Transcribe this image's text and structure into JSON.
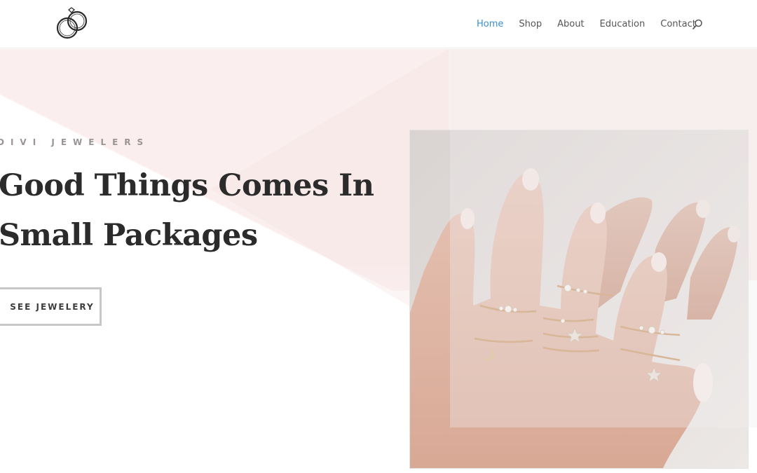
{
  "header": {
    "logo_icon": "interlocked-rings-icon",
    "nav": [
      {
        "label": "Home",
        "active": true
      },
      {
        "label": "Shop",
        "active": false
      },
      {
        "label": "About",
        "active": false
      },
      {
        "label": "Education",
        "active": false
      },
      {
        "label": "Contact",
        "active": false
      }
    ],
    "search_icon": "search-icon"
  },
  "hero": {
    "eyebrow": "DIVI JEWELERS",
    "headline_line1": "Good Things Comes In",
    "headline_line2": "Small Packages",
    "cta_label": "SEE JEWELERY",
    "image_desc": "hands-with-rings-photo"
  },
  "colors": {
    "nav_active": "#3b8fd0",
    "nav_text": "#555555",
    "hero_tint": "#fbeeee",
    "headline": "#2b2b2b"
  }
}
